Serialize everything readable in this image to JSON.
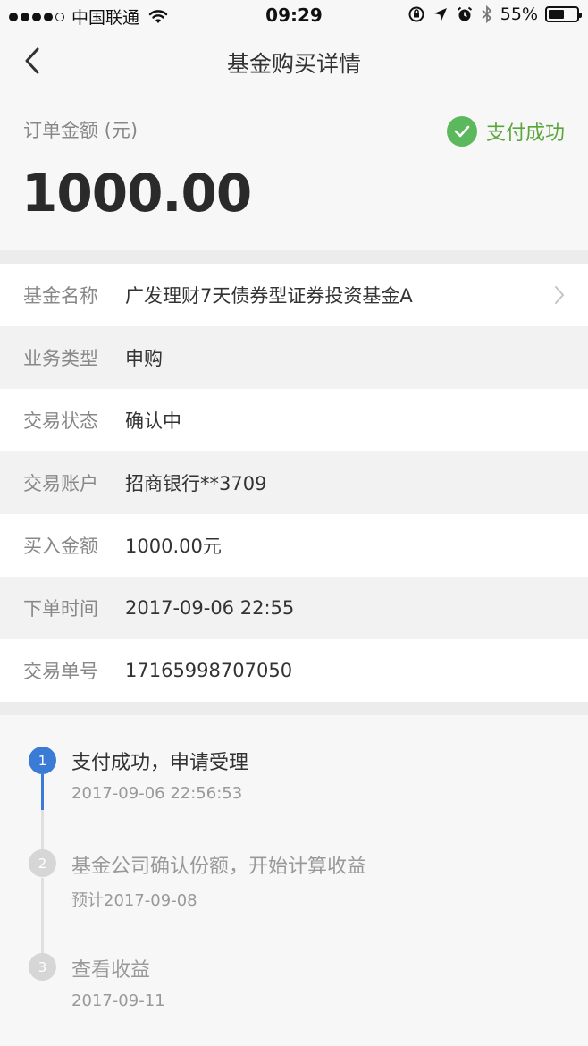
{
  "status_bar": {
    "carrier": "中国联通",
    "time": "09:29",
    "battery": "55%",
    "battery_level": 0.55
  },
  "nav": {
    "title": "基金购买详情"
  },
  "order": {
    "amount_label": "订单金额 (元)",
    "amount": "1000.00",
    "status": "支付成功",
    "status_color": "#5ba63d"
  },
  "details": [
    {
      "label": "基金名称",
      "value": "广发理财7天债券型证券投资基金A"
    },
    {
      "label": "业务类型",
      "value": "申购"
    },
    {
      "label": "交易状态",
      "value": "确认中"
    },
    {
      "label": "交易账户",
      "value": "招商银行**3709"
    },
    {
      "label": "买入金额",
      "value": "1000.00元"
    },
    {
      "label": "下单时间",
      "value": "2017-09-06 22:55"
    },
    {
      "label": "交易单号",
      "value": "17165998707050"
    }
  ],
  "timeline": [
    {
      "num": "1",
      "title": "支付成功，申请受理",
      "sub": "2017-09-06 22:56:53",
      "active": true
    },
    {
      "num": "2",
      "title": "基金公司确认份额，开始计算收益",
      "sub": "预计2017-09-08",
      "active": false
    },
    {
      "num": "3",
      "title": "查看收益",
      "sub": "2017-09-11",
      "active": false
    }
  ],
  "colors": {
    "accent_blue": "#3a7bd5",
    "success_green": "#5cb85c"
  }
}
